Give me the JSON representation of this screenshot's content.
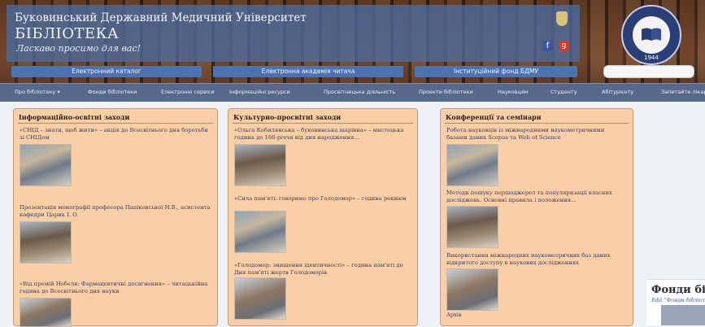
{
  "header": {
    "university": "Буковинський Державний Медичний Університет",
    "library": "БІБЛІОТЕКА",
    "slogan": "Ласкаво просимо для вас!",
    "logo_year": "1944",
    "quick_links": [
      "Електронний каталог",
      "Електронна академія читача",
      "Інституційний фонд БДМУ"
    ]
  },
  "nav": {
    "items": [
      "Про бібліотеку ▾",
      "Фонди бібліотеки",
      "Електронні сервіси",
      "Інформаційні ресурси",
      "Просвітницька діяльність",
      "Проекти бібліотеки",
      "Науковцям",
      "Студенту",
      "Абітурієнту",
      "Запитайте лікаря"
    ]
  },
  "columns": [
    {
      "title": "Інформаційно-освітні заходи",
      "items": [
        "«СНІД – знати, щоб жити» – акція до Всесвітнього дня боротьби зі СНІДом",
        "Презентація монографії професора Пашковської Н.В., асистента кафедри Царик І. О.",
        "«Від премій Нобеля: Фармацевтичні досягнення» – читацькійна година до Всесвітнього дня науки"
      ]
    },
    {
      "title": "Культурно-просвітні заходи",
      "items": [
        "«Ольга Кобилянська – буковинська шарівна» – мистецька година до 160-річчя від дня народження…",
        "«Сила пам'яті: говоримо про Голодомор» – година реквієм",
        "«Голодомор: знищення ідентичності» – година пам'яті до Дня пам'яті жертв Голодоморів"
      ]
    },
    {
      "title": "Конференції та семінари",
      "items": [
        "Робота науковців із міжнародними наукометричними базами даних Scopus та Web of Science",
        "Методи пошуку першоджерел та популяризації власних досліджень. Основні правила і положення…",
        "Використання міжнародних наукометричних баз даних відкритого доступу в наукових дослідженнях"
      ],
      "more": "Архів"
    }
  ],
  "side": {
    "title": "Фонди бібл",
    "subtitle": "Edit \"Фонди бібліотеки\""
  },
  "colors": {
    "header_banner": "#4a6ca0",
    "nav": "#56698c",
    "card": "#fbcfa5"
  }
}
